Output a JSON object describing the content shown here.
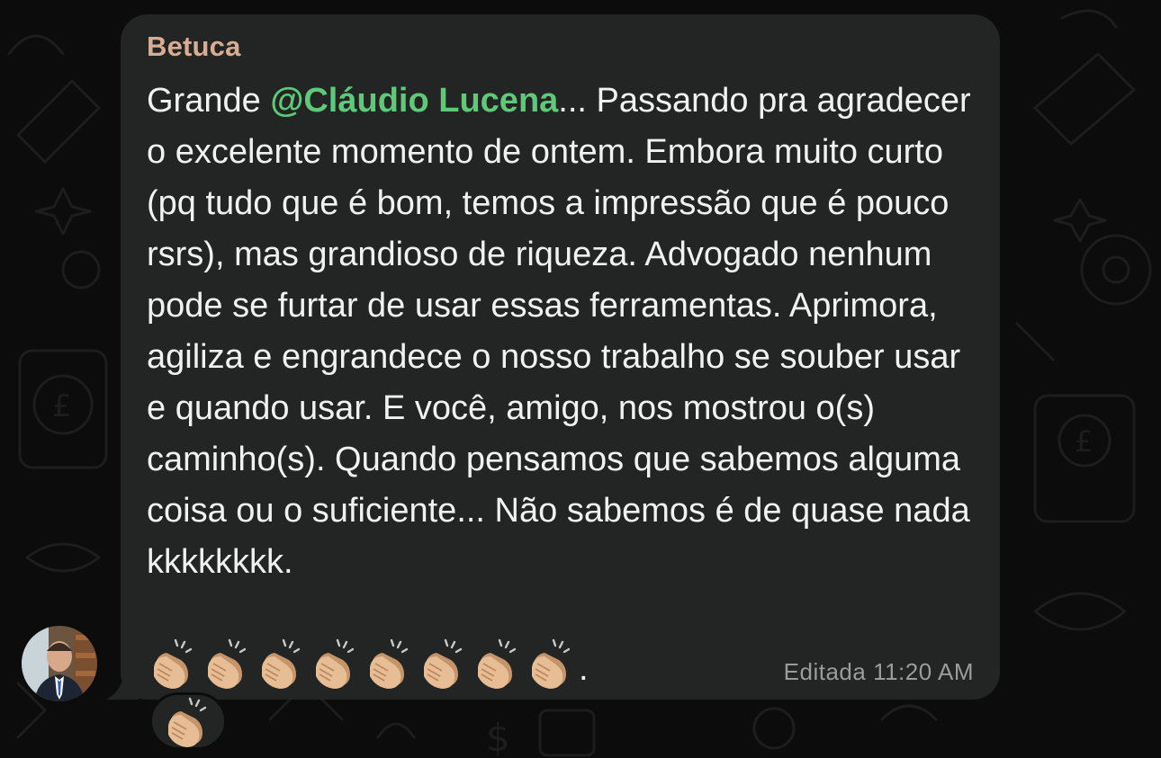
{
  "message": {
    "sender": "Betuca",
    "text_before_mention": "Grande ",
    "mention": "@Cláudio Lucena",
    "text_after_mention": "... Passando pra agradecer o excelente momento de ontem. Embora muito curto (pq tudo que é bom, temos a impressão que é pouco rsrs), mas grandioso de riqueza. Advogado nenhum pode se furtar de usar essas ferramentas. Aprimora, agiliza e engrandece o nosso trabalho se souber usar e quando usar. E você, amigo, nos mostrou o(s) caminho(s). Quando pensamos que sabemos alguma coisa ou o suficiente... Não sabemos é de quase nada kkkkkkkk.",
    "emoji_count": 8,
    "emoji": "clapping-hands-medium-light-skin",
    "trailing": ".",
    "edited_label": "Editada",
    "time": "11:20 AM"
  },
  "reaction": {
    "emoji": "clapping-hands-medium-light-skin",
    "count": 1
  },
  "colors": {
    "background": "#0c0c0c",
    "bubble": "#232524",
    "sender_name": "#d9ad93",
    "mention": "#5fc879",
    "text": "#f1f1f1",
    "meta": "#9a9c9b"
  }
}
